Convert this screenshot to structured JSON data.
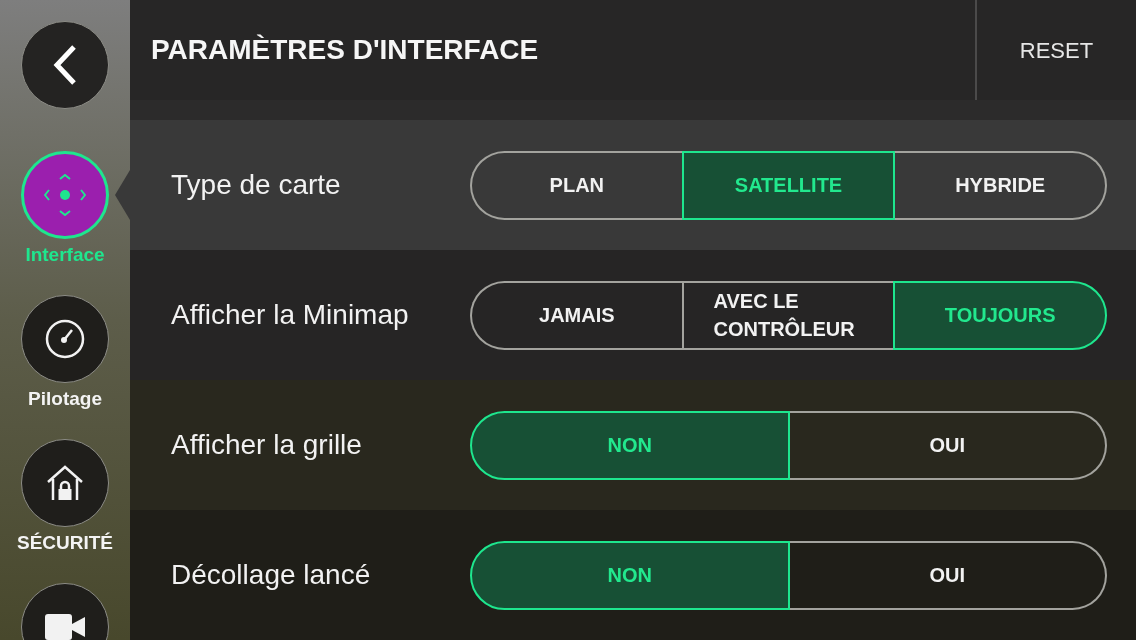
{
  "sidebar": {
    "items": [
      {
        "kind": "interface",
        "label": "Interface",
        "selected": true
      },
      {
        "kind": "gauge",
        "label": "Pilotage",
        "selected": false
      },
      {
        "kind": "security",
        "label": "SÉCURITÉ",
        "selected": false
      },
      {
        "kind": "camera",
        "selected": false
      }
    ]
  },
  "header": {
    "title": "PARAMÈTRES D'INTERFACE",
    "reset_button": "RESET"
  },
  "settings": [
    {
      "label": "Type de carte",
      "options": [
        {
          "label": "PLAN",
          "selected": false
        },
        {
          "label": "SATELLITE",
          "selected": true
        },
        {
          "label": "HYBRIDE",
          "selected": false
        }
      ]
    },
    {
      "label": "Afficher la Minimap",
      "options": [
        {
          "label": "JAMAIS",
          "selected": false
        },
        {
          "label": "AVEC LE CONTRÔLEUR",
          "selected": false
        },
        {
          "label": "TOUJOURS",
          "selected": true
        }
      ]
    },
    {
      "label": "Afficher la grille",
      "options": [
        {
          "label": "NON",
          "selected": true
        },
        {
          "label": "OUI",
          "selected": false
        }
      ]
    },
    {
      "label": "Décollage lancé",
      "options": [
        {
          "label": "NON",
          "selected": true
        },
        {
          "label": "OUI",
          "selected": false
        }
      ]
    }
  ]
}
